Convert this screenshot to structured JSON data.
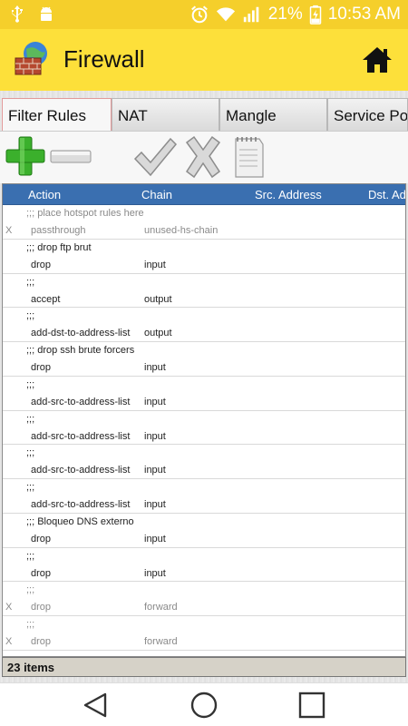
{
  "status_bar": {
    "battery_percent": "21%",
    "time": "10:53 AM",
    "icons": [
      "usb-icon",
      "android-debug-icon",
      "alarm-icon",
      "wifi-icon",
      "signal-icon",
      "battery-charging-icon"
    ],
    "background": "#f5cf2b"
  },
  "app_bar": {
    "title": "Firewall",
    "background": "#fde03a",
    "icons": [
      "firewall-logo-icon",
      "home-icon"
    ]
  },
  "tabs": [
    {
      "label": "Filter Rules",
      "active": true
    },
    {
      "label": "NAT",
      "active": false
    },
    {
      "label": "Mangle",
      "active": false
    },
    {
      "label": "Service Ports",
      "active": false
    }
  ],
  "toolbar": {
    "buttons": [
      "add-icon",
      "remove-icon",
      "enable-check-icon",
      "disable-x-icon",
      "comment-notepad-icon"
    ]
  },
  "table": {
    "header_color": "#3a6fb0",
    "columns": [
      "Action",
      "Chain",
      "Src. Address",
      "Dst. Address"
    ],
    "rows": [
      {
        "comment": ";;; place hotspot rules here",
        "flag": "X",
        "action": "passthrough",
        "chain": "unused-hs-chain",
        "disabled": true
      },
      {
        "comment": ";;; drop ftp brut",
        "flag": "",
        "action": "drop",
        "chain": "input",
        "disabled": false
      },
      {
        "comment": ";;;",
        "flag": "",
        "action": "accept",
        "chain": "output",
        "disabled": false
      },
      {
        "comment": ";;;",
        "flag": "",
        "action": "add-dst-to-address-list",
        "chain": "output",
        "disabled": false
      },
      {
        "comment": ";;; drop ssh brute forcers",
        "flag": "",
        "action": "drop",
        "chain": "input",
        "disabled": false
      },
      {
        "comment": ";;;",
        "flag": "",
        "action": "add-src-to-address-list",
        "chain": "input",
        "disabled": false
      },
      {
        "comment": ";;;",
        "flag": "",
        "action": "add-src-to-address-list",
        "chain": "input",
        "disabled": false
      },
      {
        "comment": ";;;",
        "flag": "",
        "action": "add-src-to-address-list",
        "chain": "input",
        "disabled": false
      },
      {
        "comment": ";;;",
        "flag": "",
        "action": "add-src-to-address-list",
        "chain": "input",
        "disabled": false
      },
      {
        "comment": ";;; Bloqueo DNS externo",
        "flag": "",
        "action": "drop",
        "chain": "input",
        "disabled": false
      },
      {
        "comment": ";;;",
        "flag": "",
        "action": "drop",
        "chain": "input",
        "disabled": false
      },
      {
        "comment": ";;;",
        "flag": "X",
        "action": "drop",
        "chain": "forward",
        "disabled": true
      },
      {
        "comment": ";;;",
        "flag": "X",
        "action": "drop",
        "chain": "forward",
        "disabled": true
      }
    ]
  },
  "footer": {
    "count_label": "23 items"
  },
  "nav_bar": {
    "icons": [
      "back-icon",
      "home-circle-icon",
      "recents-icon"
    ]
  }
}
